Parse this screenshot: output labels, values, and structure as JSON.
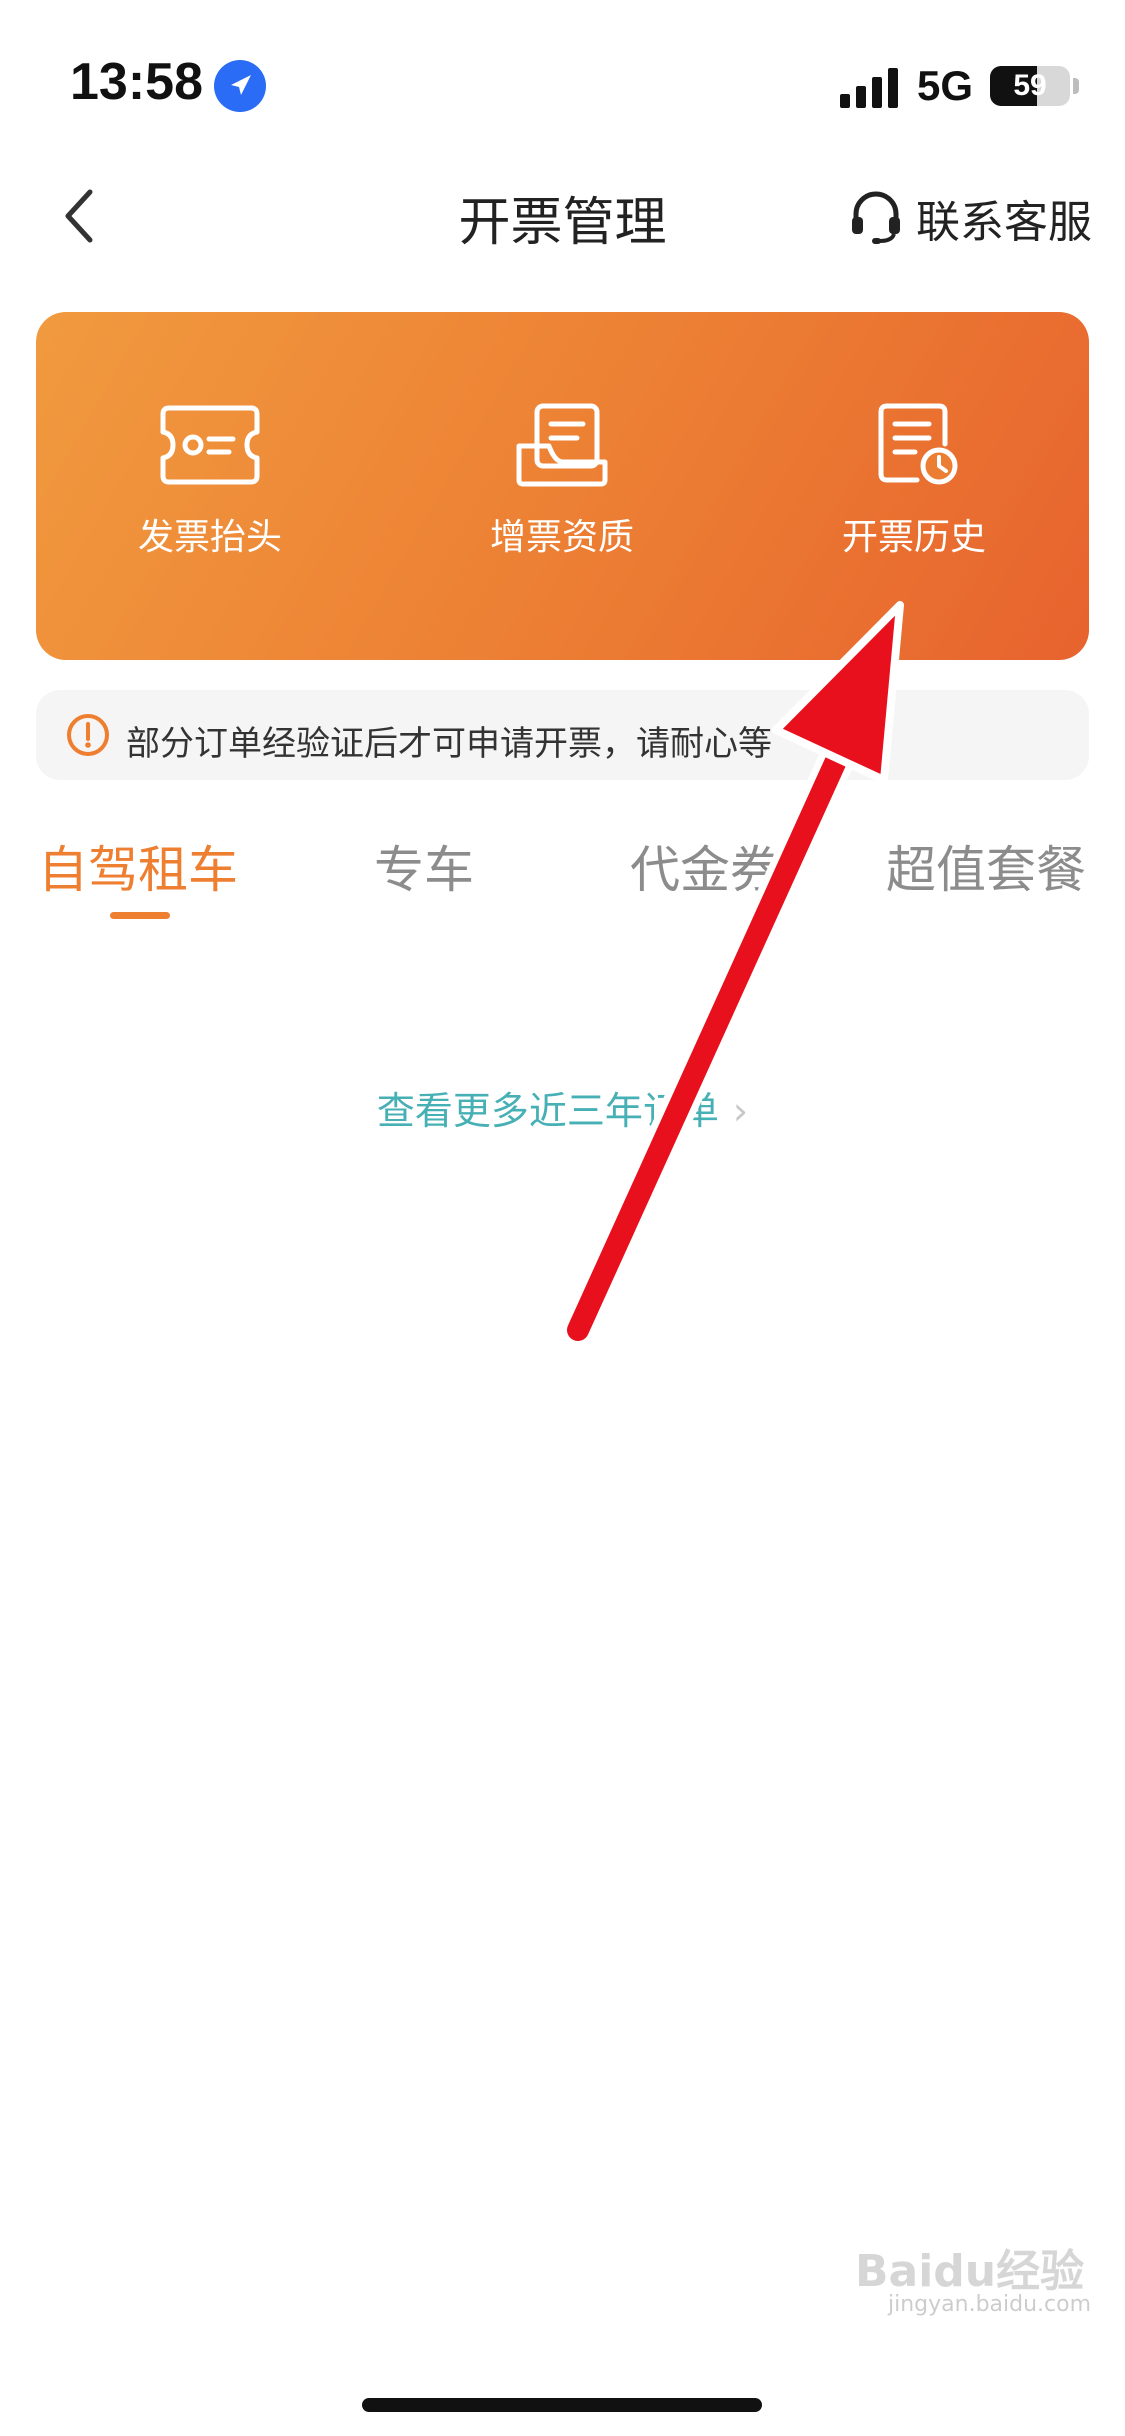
{
  "status_bar": {
    "time": "13:58",
    "network": "5G",
    "battery_percent": "59",
    "battery_level": 0.59
  },
  "nav": {
    "title": "开票管理",
    "support_label": "联系客服"
  },
  "card": {
    "items": [
      {
        "label": "发票抬头",
        "icon": "ticket-icon"
      },
      {
        "label": "增票资质",
        "icon": "document-stack-icon"
      },
      {
        "label": "开票历史",
        "icon": "document-clock-icon"
      }
    ]
  },
  "notice": {
    "text": "部分订单经验证后才可申请开票，请耐心等",
    "icon": "exclamation-circle-icon"
  },
  "tabs": {
    "items": [
      "自驾租车",
      "专车",
      "代金券",
      "超值套餐"
    ],
    "active_index": 0
  },
  "more_link": {
    "label": "查看更多近三年订单"
  },
  "watermark": {
    "text": "Baidu经验",
    "sub": "jingyan.baidu.com"
  },
  "colors": {
    "accent": "#ee7e30",
    "link": "#47b0b5",
    "annotation": "#e8101c"
  }
}
